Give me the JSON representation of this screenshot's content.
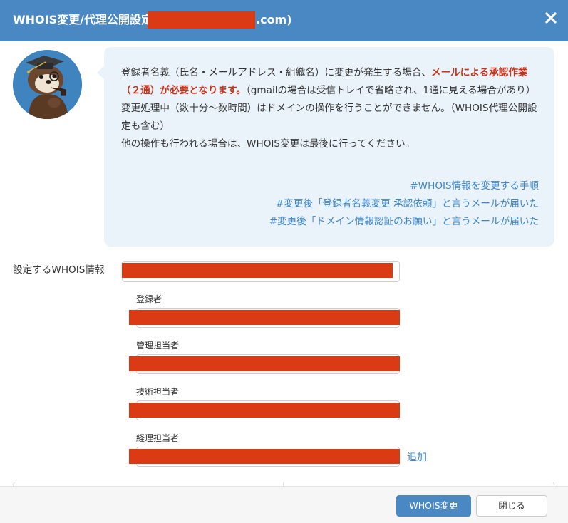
{
  "header": {
    "title_prefix": "WHOIS変更/代理公開設定",
    "title_suffix": ".com)"
  },
  "notice": {
    "line1_normal": "登録者名義（氏名・メールアドレス・組織名）に変更が発生する場合、",
    "line1_warn": "メールによる承認作業（２通）が必要となります。",
    "line1_tail": "（gmailの場合は受信トレイで省略され、1通に見える場合があり）",
    "line2": "変更処理中（数十分〜数時間）はドメインの操作を行うことができません。（WHOIS代理公開設定も含む）",
    "line3": "他の操作も行われる場合は、WHOIS変更は最後に行ってください。",
    "links": [
      "#WHOIS情報を変更する手順",
      "#変更後「登録者名義変更 承認依頼」と言うメールが届いた",
      "#変更後「ドメイン情報認証のお願い」と言うメールが届いた"
    ]
  },
  "form": {
    "main_label": "設定するWHOIS情報",
    "registrant_label": "登録者",
    "admin_label": "管理担当者",
    "tech_label": "技術担当者",
    "billing_label": "経理担当者",
    "add_label": "追加"
  },
  "footer": {
    "primary_label": "WHOIS変更",
    "close_label": "閉じる"
  },
  "colors": {
    "header": "#4a88c4",
    "warn": "#c8331a",
    "link": "#3c86c9",
    "redaction": "#db3b14",
    "bubble": "#eaf2fa"
  }
}
